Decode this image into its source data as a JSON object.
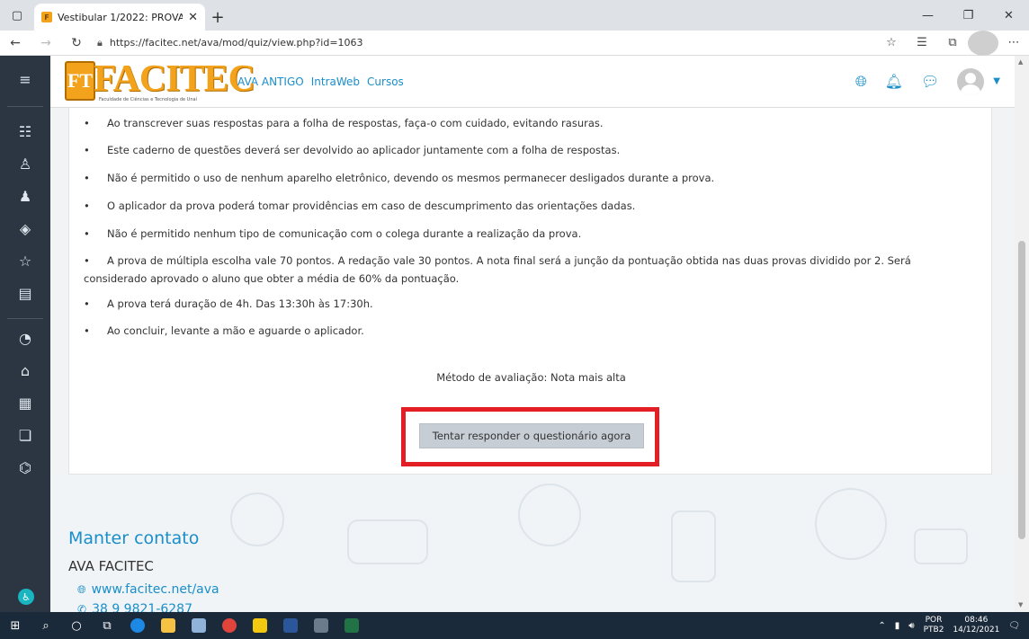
{
  "browser": {
    "tab_title": "Vestibular 1/2022: PROVA",
    "url": "https://facitec.net/ava/mod/quiz/view.php?id=1063"
  },
  "navbar": {
    "logo_text": "FACITEC",
    "logo_subtitle": "Faculdade de Ciências e Tecnologia de Unaí",
    "links": [
      "AVA ANTIGO",
      "IntraWeb",
      "Cursos"
    ]
  },
  "sidebar": {
    "icons": [
      "menu-icon",
      "list-icon",
      "user-icon",
      "users-icon",
      "layers-icon",
      "star-icon",
      "book-icon",
      "dashboard-icon",
      "home-icon",
      "calendar-icon",
      "files-icon",
      "graduation-cap-icon",
      "accessibility-icon"
    ]
  },
  "quiz": {
    "rules": [
      "Ao transcrever suas respostas para a folha de respostas, faça-o com cuidado, evitando rasuras.",
      "Este caderno de questões deverá ser devolvido ao aplicador juntamente com a folha de respostas.",
      "Não é permitido o uso de nenhum aparelho eletrônico, devendo os mesmos permanecer desligados durante a prova.",
      "O aplicador da prova poderá tomar providências em caso de descumprimento das orientações dadas.",
      "Não é permitido nenhum tipo de comunicação com o colega durante a realização da prova.",
      "A prova de múltipla escolha vale 70 pontos. A redação vale 30 pontos. A nota final será a junção da pontuação obtida nas duas provas dividido por 2. Será considerado aprovado o aluno que obter a média de 60% da pontuação.",
      "A prova terá duração de 4h. Das 13:30h às 17:30h.",
      "Ao concluir, levante a mão e aguarde o aplicador."
    ],
    "bullet": "•",
    "method": "Método de avaliação: Nota mais alta",
    "attempt_button": "Tentar responder o questionário agora"
  },
  "footer": {
    "heading": "Manter contato",
    "brand": "AVA FACITEC",
    "website": "www.facitec.net/ava",
    "phone": "38 9 9821-6287"
  },
  "taskbar": {
    "lang_top": "POR",
    "lang_bottom": "PTB2",
    "time": "08:46",
    "date": "14/12/2021"
  },
  "colors": {
    "accent": "#1a8ec9",
    "sidebar": "#2b3642",
    "logo": "#f3a21b",
    "highlight": "#e31e24"
  }
}
